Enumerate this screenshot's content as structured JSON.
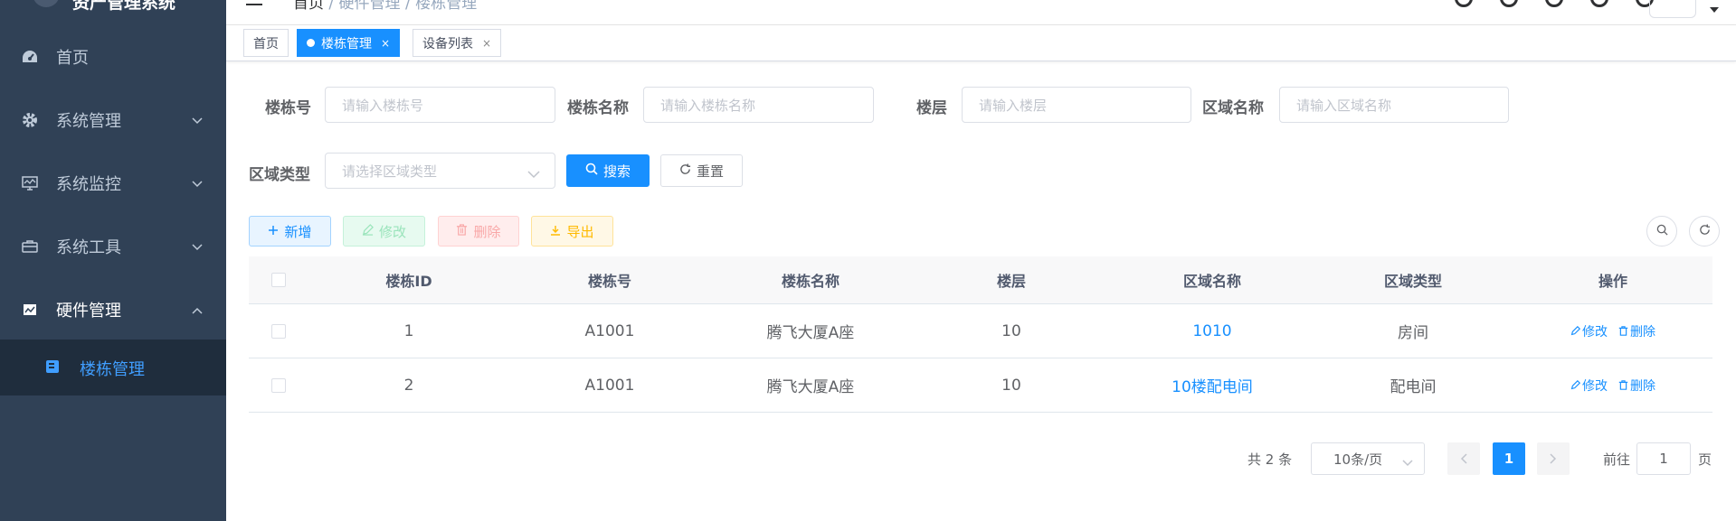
{
  "sidebar": {
    "logo_text": "资产管理系统",
    "items": [
      {
        "label": "首页",
        "icon": "dashboard-icon"
      },
      {
        "label": "系统管理",
        "icon": "gear-icon"
      },
      {
        "label": "系统监控",
        "icon": "monitor-icon"
      },
      {
        "label": "系统工具",
        "icon": "toolbox-icon"
      },
      {
        "label": "硬件管理",
        "icon": "hardware-icon"
      }
    ],
    "active_sub": {
      "label": "楼栋管理",
      "icon": "building-icon"
    }
  },
  "navbar": {
    "breadcrumb": [
      "首页",
      "硬件管理",
      "楼栋管理"
    ],
    "separator": " / "
  },
  "tags": [
    {
      "label": "首页",
      "active": false
    },
    {
      "label": "楼栋管理",
      "active": true,
      "close": "×"
    },
    {
      "label": "设备列表",
      "active": false,
      "close": "×"
    }
  ],
  "search": {
    "building_no": {
      "label": "楼栋号",
      "placeholder": "请输入楼栋号"
    },
    "building_name": {
      "label": "楼栋名称",
      "placeholder": "请输入楼栋名称"
    },
    "floor": {
      "label": "楼层",
      "placeholder": "请输入楼层"
    },
    "area_name": {
      "label": "区域名称",
      "placeholder": "请输入区域名称"
    },
    "area_type": {
      "label": "区域类型",
      "placeholder": "请选择区域类型"
    },
    "search_btn": "搜索",
    "reset_btn": "重置"
  },
  "toolbar": {
    "add": "新增",
    "edit": "修改",
    "delete": "删除",
    "export": "导出"
  },
  "table": {
    "headers": [
      "楼栋ID",
      "楼栋号",
      "楼栋名称",
      "楼层",
      "区域名称",
      "区域类型",
      "操作"
    ],
    "rows": [
      {
        "id": "1",
        "no": "A1001",
        "name": "腾飞大厦A座",
        "floor": "10",
        "area": "1010",
        "type": "房间"
      },
      {
        "id": "2",
        "no": "A1001",
        "name": "腾飞大厦A座",
        "floor": "10",
        "area": "10楼配电间",
        "type": "配电间"
      }
    ],
    "op_edit": "修改",
    "op_delete": "删除"
  },
  "pagination": {
    "total_text": "共 2 条",
    "page_size": "10条/页",
    "current": "1",
    "goto_label": "前往",
    "goto_value": "1",
    "page_unit": "页"
  },
  "colors": {
    "sidebar_bg": "#304156",
    "primary": "#1890ff",
    "submenu_bg": "#1f2d3d"
  }
}
